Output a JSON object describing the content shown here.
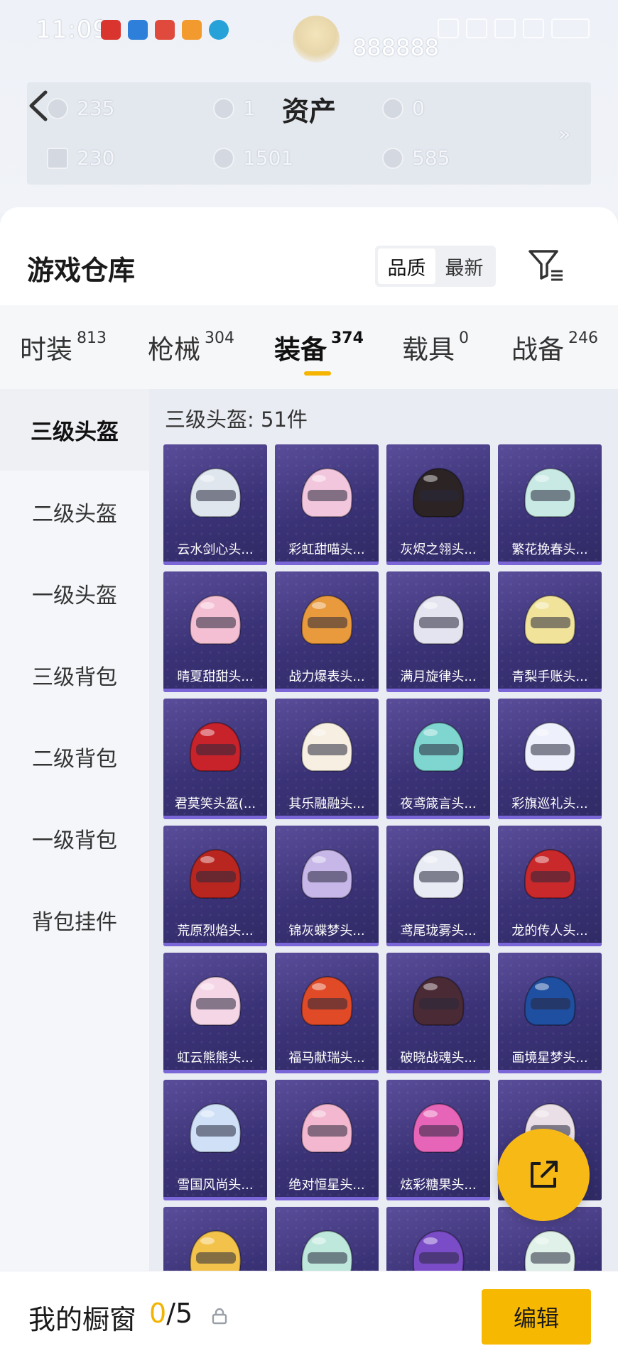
{
  "status_bar": {
    "time": "11:09"
  },
  "header": {
    "title": "资产",
    "medal_value": "888888",
    "assets": [
      {
        "icon": "ticket-icon",
        "value": "235"
      },
      {
        "icon": "silver-coin-icon",
        "value": "1"
      },
      {
        "icon": "gold-coin-icon",
        "value": "0"
      },
      {
        "icon": "card-icon",
        "value": "230"
      },
      {
        "icon": "bp-coin-icon",
        "value": "1501"
      },
      {
        "icon": "bronze-coin-icon",
        "value": "585"
      }
    ]
  },
  "warehouse": {
    "title": "游戏仓库",
    "sort_options": [
      "品质",
      "最新"
    ],
    "active_sort": "品质"
  },
  "tabs": [
    {
      "label": "时装",
      "count": "813"
    },
    {
      "label": "枪械",
      "count": "304"
    },
    {
      "label": "装备",
      "count": "374"
    },
    {
      "label": "载具",
      "count": "0"
    },
    {
      "label": "战备",
      "count": "246"
    }
  ],
  "active_tab": "装备",
  "categories": [
    "三级头盔",
    "二级头盔",
    "一级头盔",
    "三级背包",
    "二级背包",
    "一级背包",
    "背包挂件"
  ],
  "active_category": "三级头盔",
  "grid": {
    "header": "三级头盔: 51件",
    "items": [
      {
        "name": "云水剑心头...",
        "color": "#dfe6ee"
      },
      {
        "name": "彩虹甜喵头...",
        "color": "#f2c6dc"
      },
      {
        "name": "灰烬之翎头...",
        "color": "#2b2324"
      },
      {
        "name": "繁花挽春头...",
        "color": "#c9eae4"
      },
      {
        "name": "晴夏甜甜头...",
        "color": "#f4bfd3"
      },
      {
        "name": "战力爆表头...",
        "color": "#e89a3c"
      },
      {
        "name": "满月旋律头...",
        "color": "#e4e4f0"
      },
      {
        "name": "青梨手账头...",
        "color": "#f1e39a"
      },
      {
        "name": "君莫笑头盔(...",
        "color": "#c8222a"
      },
      {
        "name": "其乐融融头...",
        "color": "#f6efe2"
      },
      {
        "name": "夜鸢箴言头...",
        "color": "#7fd6d0"
      },
      {
        "name": "彩旗巡礼头...",
        "color": "#eef0fb"
      },
      {
        "name": "荒原烈焰头...",
        "color": "#b8261f"
      },
      {
        "name": "锦灰蝶梦头...",
        "color": "#c7b6e8"
      },
      {
        "name": "鸢尾珑雾头...",
        "color": "#e9ebf4"
      },
      {
        "name": "龙的传人头...",
        "color": "#c9292b"
      },
      {
        "name": "虹云熊熊头...",
        "color": "#f5d6e6"
      },
      {
        "name": "福马献瑞头...",
        "color": "#e04a26"
      },
      {
        "name": "破晓战魂头...",
        "color": "#4a2a34"
      },
      {
        "name": "画境星梦头...",
        "color": "#1f4fa0"
      },
      {
        "name": "雪国风尚头...",
        "color": "#cfe0f7"
      },
      {
        "name": "绝对恒星头...",
        "color": "#f3b7cf"
      },
      {
        "name": "炫彩糖果头...",
        "color": "#e765b9"
      },
      {
        "name": "",
        "color": "#eadfe6"
      },
      {
        "name": "",
        "color": "#f2c24a"
      },
      {
        "name": "",
        "color": "#bfe8dc"
      },
      {
        "name": "",
        "color": "#7b4cc7"
      },
      {
        "name": "",
        "color": "#dff1e8"
      }
    ]
  },
  "bottom_bar": {
    "showcase_label": "我的橱窗",
    "showcase_current": "0",
    "showcase_total": "/5",
    "edit_label": "编辑"
  },
  "colors": {
    "accent": "#f6b800",
    "card_bg": "#3a3276"
  }
}
